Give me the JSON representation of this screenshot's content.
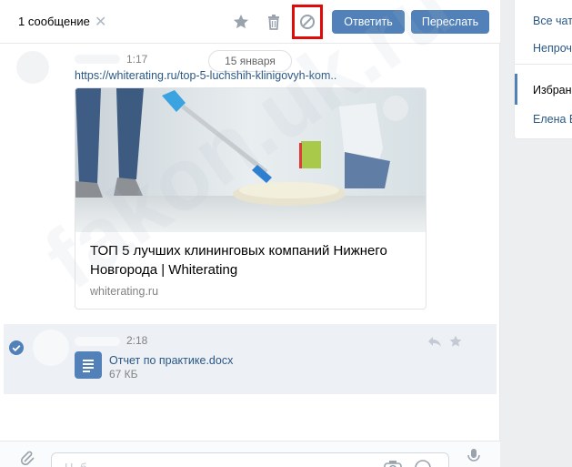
{
  "toolbar": {
    "selection_count": "1 сообщение",
    "clear_icon": "close-icon",
    "icons": [
      "star-icon",
      "trash-icon",
      "block-icon"
    ],
    "reply_label": "Ответить",
    "forward_label": "Переслать"
  },
  "messages": [
    {
      "time": "1:17",
      "link": "https://whiterating.ru/top-5-luchshih-klinigovyh-kom..",
      "card": {
        "title": "ТОП 5 лучших клининговых компаний Нижнего Новгорода | Whiterating",
        "domain": "whiterating.ru"
      }
    },
    {
      "time": "2:18",
      "selected": true,
      "attachment": {
        "name": "Отчет по практике.docx",
        "size": "67 КБ"
      }
    }
  ],
  "date_divider": "15 января",
  "composer": {
    "placeholder": "Н       б"
  },
  "sidebar": {
    "items": [
      {
        "label": "Все чат",
        "active": false
      },
      {
        "label": "Непроч",
        "active": false
      },
      {
        "label": "Избран",
        "active": true
      },
      {
        "label": "Елена Е",
        "active": false
      }
    ]
  },
  "watermark": "fakon.uk.ru",
  "colors": {
    "accent": "#5181b8",
    "link": "#2a5885",
    "highlight": "#e00a0a",
    "selected_bg": "#edf0f5"
  }
}
